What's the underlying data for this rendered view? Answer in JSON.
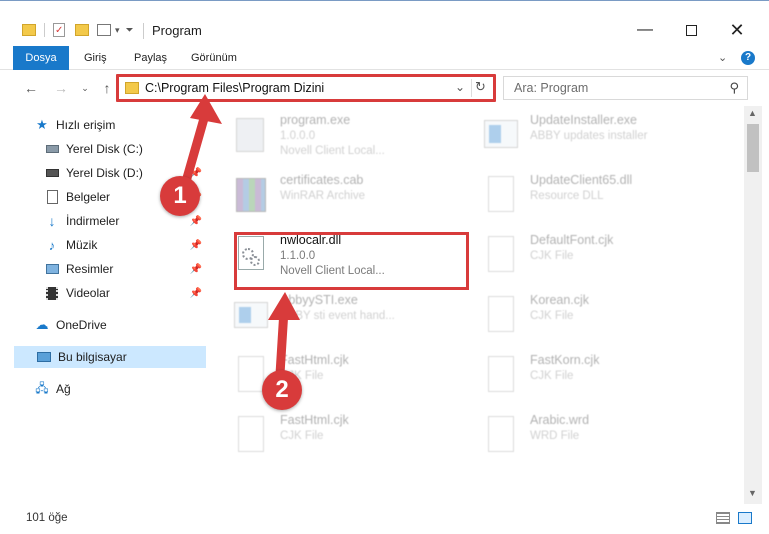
{
  "window": {
    "title": "Program",
    "minimize_icon": "minimize-icon",
    "maximize_icon": "maximize-icon",
    "close_icon": "close-icon"
  },
  "ribbon": {
    "tabs": [
      {
        "label": "Dosya"
      },
      {
        "label": "Giriş"
      },
      {
        "label": "Paylaş"
      },
      {
        "label": "Görünüm"
      }
    ]
  },
  "address": {
    "path": "C:\\Program Files\\Program Dizini",
    "search_placeholder": "Ara: Program"
  },
  "sidebar": {
    "items": [
      {
        "label": "Hızlı erişim",
        "icon": "star-icon"
      },
      {
        "label": "Yerel Disk (C:)",
        "icon": "drive-icon"
      },
      {
        "label": "Yerel Disk (D:)",
        "icon": "drive-icon"
      },
      {
        "label": "Belgeler",
        "icon": "documents-icon"
      },
      {
        "label": "İndirmeler",
        "icon": "download-icon"
      },
      {
        "label": "Müzik",
        "icon": "music-icon"
      },
      {
        "label": "Resimler",
        "icon": "pictures-icon"
      },
      {
        "label": "Videolar",
        "icon": "videos-icon"
      },
      {
        "label": "OneDrive",
        "icon": "cloud-icon"
      },
      {
        "label": "Bu bilgisayar",
        "icon": "computer-icon"
      },
      {
        "label": "Ağ",
        "icon": "network-icon"
      }
    ]
  },
  "files": [
    {
      "name": "program.exe",
      "line2": "1.0.0.0",
      "line3": "Novell Client Local..."
    },
    {
      "name": "UpdateInstaller.exe",
      "line2": "ABBY updates installer",
      "line3": ""
    },
    {
      "name": "certificates.cab",
      "line2": "WinRAR Archive",
      "line3": ""
    },
    {
      "name": "UpdateClient65.dll",
      "line2": "Resource DLL",
      "line3": ""
    },
    {
      "name": "nwlocalr.dll",
      "line2": "1.1.0.0",
      "line3": "Novell Client Local..."
    },
    {
      "name": "DefaultFont.cjk",
      "line2": "CJK File",
      "line3": ""
    },
    {
      "name": "AbbyySTI.exe",
      "line2": "ABBY sti event hand...",
      "line3": ""
    },
    {
      "name": "Korean.cjk",
      "line2": "CJK File",
      "line3": ""
    },
    {
      "name": "FastHtml.cjk",
      "line2": "CJK File",
      "line3": ""
    },
    {
      "name": "FastKorn.cjk",
      "line2": "CJK File",
      "line3": ""
    },
    {
      "name": "FastHtml.cjk",
      "line2": "CJK File",
      "line3": ""
    },
    {
      "name": "Arabic.wrd",
      "line2": "WRD File",
      "line3": ""
    }
  ],
  "status": {
    "count": "101 öğe"
  },
  "callouts": {
    "one": "1",
    "two": "2",
    "color": "#d83b3b"
  }
}
